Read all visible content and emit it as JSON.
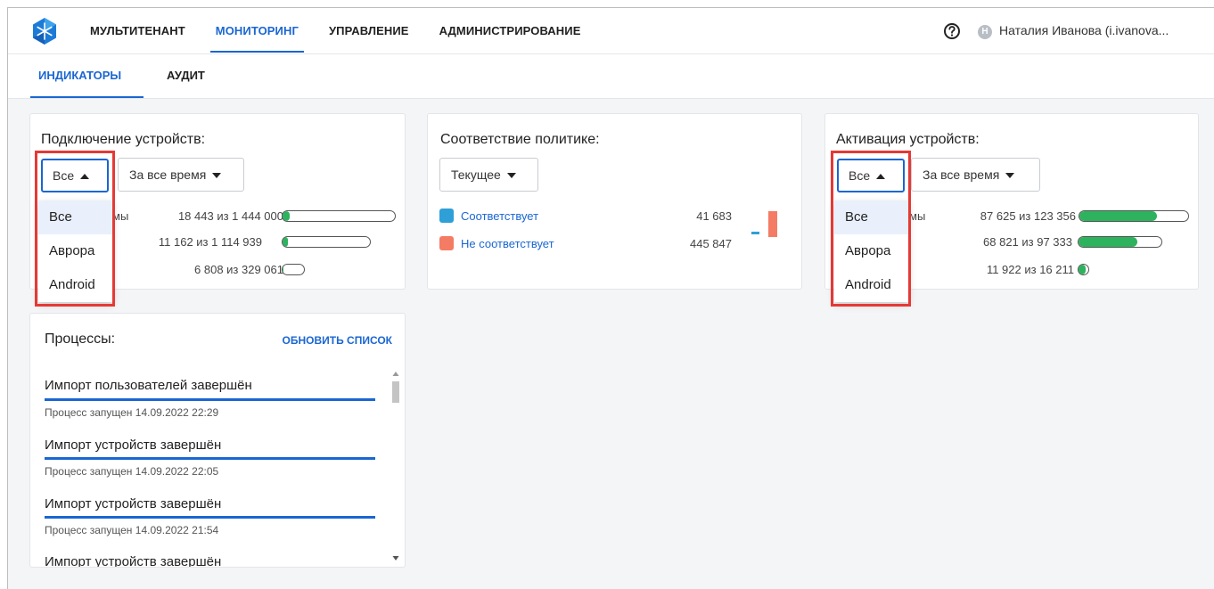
{
  "header": {
    "nav": [
      "МУЛЬТИТЕНАНТ",
      "МОНИТОРИНГ",
      "УПРАВЛЕНИЕ",
      "АДМИНИСТРИРОВАНИЕ"
    ],
    "active_nav": "МОНИТОРИНГ",
    "avatar_initial": "Н",
    "user_name": "Наталия Иванова (i.ivanova..."
  },
  "subtabs": [
    "ИНДИКАТОРЫ",
    "АУДИТ"
  ],
  "device_connection": {
    "title": "Подключение устройств:",
    "platform_select": "Все",
    "period_select": "За все время",
    "dropdown_options": [
      "Все",
      "Аврора",
      "Android"
    ],
    "partial_label": "мы",
    "rows": [
      {
        "text": "18 443 из 1 444 000",
        "fraction": 0.013
      },
      {
        "text": "11 162 из 1 114 939",
        "fraction": 0.01
      },
      {
        "text": "6 808 из 329 061",
        "fraction": 0.021
      }
    ]
  },
  "policy_compliance": {
    "title": "Соответствие политике:",
    "select": "Текущее",
    "legend": [
      {
        "label": "Соответствует",
        "value": "41 683",
        "color": "#2f9fd8"
      },
      {
        "label": "Не соответствует",
        "value": "445 847",
        "color": "#f47c65"
      }
    ]
  },
  "device_activation": {
    "title": "Активация устройств:",
    "platform_select": "Все",
    "period_select": "За все время",
    "dropdown_options": [
      "Все",
      "Аврора",
      "Android"
    ],
    "partial_label": "мы",
    "rows": [
      {
        "text": "87 625 из 123 356",
        "fraction": 0.71
      },
      {
        "text": "68 821 из 97 333",
        "fraction": 0.707
      },
      {
        "text": "11 922 из 16 211",
        "fraction": 0.735
      }
    ]
  },
  "processes": {
    "title": "Процессы:",
    "refresh_label": "ОБНОВИТЬ СПИСОК",
    "items": [
      {
        "title": "Импорт пользователей завершён",
        "subtitle": "Процесс запущен 14.09.2022 22:29"
      },
      {
        "title": "Импорт устройств завершён",
        "subtitle": "Процесс запущен 14.09.2022 22:05"
      },
      {
        "title": "Импорт устройств завершён",
        "subtitle": "Процесс запущен 14.09.2022 21:54"
      },
      {
        "title": "Импорт устройств завершён",
        "subtitle": ""
      }
    ]
  },
  "colors": {
    "accent": "#1a66d2",
    "success": "#2db35d",
    "highlight": "#e53935"
  }
}
